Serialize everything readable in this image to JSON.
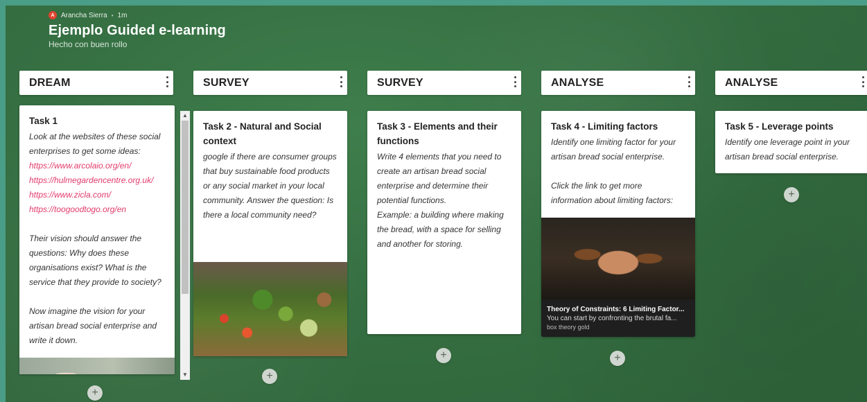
{
  "board": {
    "author": "Arancha Sierra",
    "author_initial": "A",
    "time_ago": "1m",
    "dot": "•",
    "title": "Ejemplo Guided e-learning",
    "subtitle": "Hecho con buen rollo"
  },
  "columns": [
    {
      "title": "DREAM",
      "card": {
        "title": "Task 1",
        "lines": [
          {
            "type": "text",
            "text": "Look at the websites of these social enterprises to get some ideas:"
          },
          {
            "type": "link",
            "text": "https://www.arcolaio.org/en/"
          },
          {
            "type": "link",
            "text": "https://hulmegardencentre.org.uk/"
          },
          {
            "type": "link",
            "text": "https://www.zicla.com/"
          },
          {
            "type": "link",
            "text": "https://toogoodtogo.org/en"
          },
          {
            "type": "text",
            "text": "Their vision should answer the questions: Why does these organisations exist? What is the service that they provide to society?"
          },
          {
            "type": "text",
            "text": "Now imagine the vision for your artisan bread social enterprise and write it down."
          }
        ]
      }
    },
    {
      "title": "SURVEY",
      "card": {
        "title": "Task 2 - Natural and Social context",
        "body": "google if there are consumer groups  that buy sustainable food products or any social market in your local community. Answer the question: Is there a local community need?"
      }
    },
    {
      "title": "SURVEY",
      "card": {
        "title": "Task 3 - Elements and their functions",
        "body": "Write 4 elements that you need to create an artisan bread social enterprise and determine their potential functions.",
        "body2": "Example: a building where making the bread, with a space for selling and another for storing."
      }
    },
    {
      "title": "ANALYSE",
      "card": {
        "title": "Task 4 - Limiting factors",
        "body": "Identify one limiting factor for your artisan bread social enterprise.",
        "body2": "Click the link to get more information about limiting factors:",
        "link_preview": {
          "title": "Theory of Constraints: 6 Limiting Factor...",
          "description": "You can start by confronting the brutal fa...",
          "site": "box theory gold"
        }
      }
    },
    {
      "title": "ANALYSE",
      "card": {
        "title": "Task 5 - Leverage points",
        "body": "Identify one leverage point in your artisan bread social enterprise."
      }
    }
  ],
  "add_post_symbol": "+",
  "menu_symbol": "⋮",
  "colors": {
    "board_bg": "#356f42",
    "frame": "#4a9d86",
    "link": "#e23b6d",
    "avatar": "#e0442f"
  }
}
